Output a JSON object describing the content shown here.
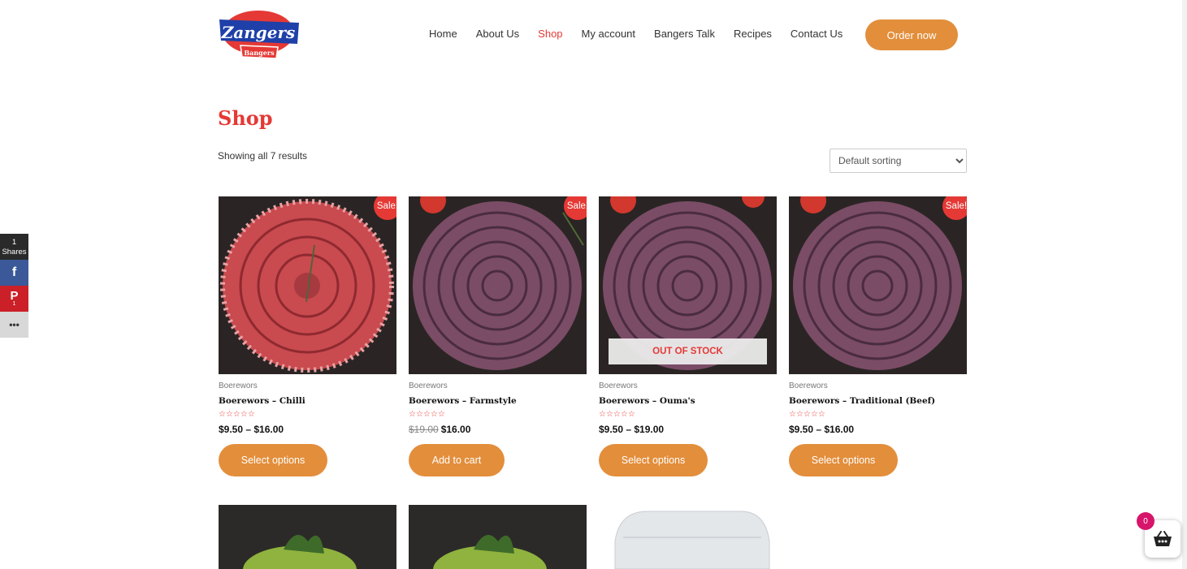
{
  "header": {
    "logo_main": "Zangers",
    "logo_sub": "Bangers",
    "nav": [
      {
        "label": "Home",
        "active": false
      },
      {
        "label": "About Us",
        "active": false
      },
      {
        "label": "Shop",
        "active": true
      },
      {
        "label": "My account",
        "active": false
      },
      {
        "label": "Bangers Talk",
        "active": false
      },
      {
        "label": "Recipes",
        "active": false
      },
      {
        "label": "Contact Us",
        "active": false
      }
    ],
    "order_button": "Order now"
  },
  "page": {
    "title": "Shop",
    "results_text": "Showing all 7 results",
    "sort_selected": "Default sorting"
  },
  "products": [
    {
      "category": "Boerewors",
      "name": "Boerewors – Chilli",
      "sale_badge": "Sale!",
      "old_price": "",
      "price": "$9.50 – $16.00",
      "cta": "Select options",
      "stock_label": "",
      "rating_stars": "☆☆☆☆☆"
    },
    {
      "category": "Boerewors",
      "name": "Boerewors – Farmstyle",
      "sale_badge": "Sale!",
      "old_price": "$19.00",
      "price": "$16.00",
      "cta": "Add to cart",
      "stock_label": "",
      "rating_stars": "☆☆☆☆☆"
    },
    {
      "category": "Boerewors",
      "name": "Boerewors – Ouma's",
      "sale_badge": "",
      "old_price": "",
      "price": "$9.50 – $19.00",
      "cta": "Select options",
      "stock_label": "OUT OF STOCK",
      "rating_stars": "☆☆☆☆☆"
    },
    {
      "category": "Boerewors",
      "name": "Boerewors – Traditional (Beef)",
      "sale_badge": "Sale!",
      "old_price": "",
      "price": "$9.50 – $16.00",
      "cta": "Select options",
      "stock_label": "",
      "rating_stars": "☆☆☆☆☆"
    }
  ],
  "share": {
    "count": "1",
    "count_label": "Shares",
    "pinterest_count": "1"
  },
  "cart": {
    "count": "0"
  },
  "colors": {
    "accent": "#e38e3b",
    "brand_red": "#e53935",
    "cart_badge": "#d6156b"
  }
}
